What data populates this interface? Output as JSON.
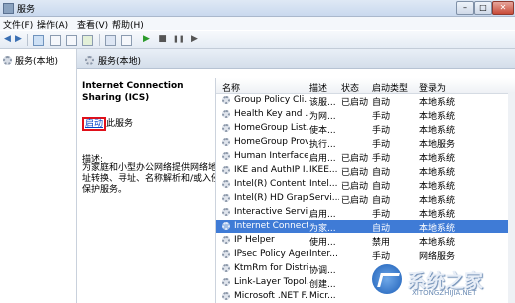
{
  "window": {
    "title": "服务"
  },
  "window_controls": {
    "minimize": "–",
    "maximize": "□",
    "close": "✕"
  },
  "menu": [
    "文件(F)",
    "操作(A)",
    "查看(V)",
    "帮助(H)"
  ],
  "toolbar": {
    "play": "▶",
    "stop": "■",
    "pause": "❚❚",
    "restart": "▶"
  },
  "tree": {
    "root_label": "服务(本地)"
  },
  "header": {
    "label": "服务(本地)"
  },
  "detail": {
    "service_name": "Internet Connection Sharing (ICS)",
    "start_link": "启动",
    "start_suffix": "此服务",
    "desc_label": "描述:",
    "description": "为家庭和小型办公网络提供网络地址转换、寻址、名称解析和/或入侵保护服务。"
  },
  "columns": [
    "名称",
    "描述",
    "状态",
    "启动类型",
    "登录为"
  ],
  "services": [
    {
      "name": "Group Policy Cli...",
      "desc": "该服...",
      "status": "已启动",
      "startup": "自动",
      "logon": "本地系统"
    },
    {
      "name": "Health Key and ...",
      "desc": "为网...",
      "status": "",
      "startup": "手动",
      "logon": "本地系统"
    },
    {
      "name": "HomeGroup List...",
      "desc": "使本...",
      "status": "",
      "startup": "手动",
      "logon": "本地系统"
    },
    {
      "name": "HomeGroup Provi...",
      "desc": "执行...",
      "status": "",
      "startup": "手动",
      "logon": "本地服务"
    },
    {
      "name": "Human Interface...",
      "desc": "启用...",
      "status": "已启动",
      "startup": "手动",
      "logon": "本地系统"
    },
    {
      "name": "IKE and AuthIP I...",
      "desc": "IKEE...",
      "status": "已启动",
      "startup": "自动",
      "logon": "本地系统"
    },
    {
      "name": "Intel(R) Content ...",
      "desc": "Intel...",
      "status": "已启动",
      "startup": "自动",
      "logon": "本地系统"
    },
    {
      "name": "Intel(R) HD Grap...",
      "desc": "Servi...",
      "status": "已启动",
      "startup": "自动",
      "logon": "本地系统"
    },
    {
      "name": "Interactive Servi...",
      "desc": "启用...",
      "status": "",
      "startup": "手动",
      "logon": "本地系统"
    },
    {
      "name": "Internet Connect...",
      "desc": "为家...",
      "status": "",
      "startup": "自动",
      "logon": "本地系统"
    },
    {
      "name": "IP Helper",
      "desc": "使用...",
      "status": "",
      "startup": "禁用",
      "logon": "本地系统"
    },
    {
      "name": "IPsec Policy Agent",
      "desc": "Inter...",
      "status": "",
      "startup": "手动",
      "logon": "网络服务"
    },
    {
      "name": "KtmRm for Distri...",
      "desc": "协调...",
      "status": "",
      "startup": "",
      "logon": ""
    },
    {
      "name": "Link-Layer Topol...",
      "desc": "创建...",
      "status": "",
      "startup": "",
      "logon": ""
    },
    {
      "name": "Microsoft .NET F...",
      "desc": "Micr...",
      "status": "",
      "startup": "",
      "logon": ""
    }
  ],
  "selected_index": 9,
  "watermark": {
    "text": "系统之家",
    "sub": "XITONGZHIJIA.NET"
  },
  "colors": {
    "selection": "#3f7bd6",
    "link": "#0645c8",
    "highlight_box": "#e0101a"
  }
}
